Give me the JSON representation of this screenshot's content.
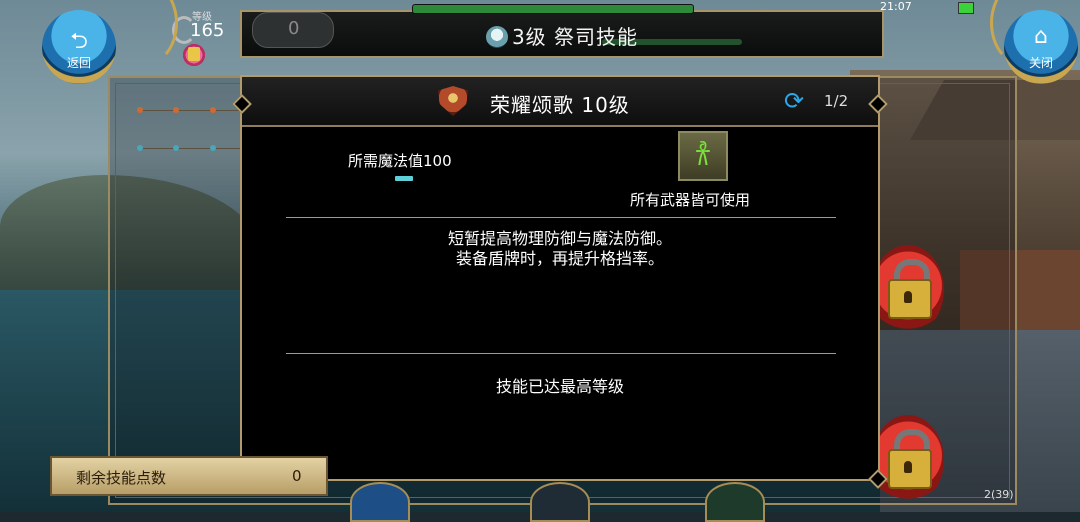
{
  "header": {
    "title": "3级 祭司技能",
    "level_label": "等级",
    "level_value": "165",
    "counter_value": "0",
    "clock": "21:07",
    "back_label": "返回",
    "close_label": "关闭"
  },
  "dialog": {
    "skill_name": "荣耀颂歌 10级",
    "page": "1/2",
    "mana_requirement": "所需魔法值100",
    "weapon_text": "所有武器皆可使用",
    "description_line1": "短暂提高物理防御与魔法防御。",
    "description_line2": "装备盾牌时，再提升格挡率。",
    "max_level_text": "技能已达最高等级"
  },
  "skill_points": {
    "label": "剩余技能点数",
    "value": "0"
  },
  "bottom": {
    "right_text": "2(39)"
  },
  "colors": {
    "gold_border": "#b29c6e",
    "accent_blue": "#2aa8e8",
    "mana_cyan": "#5fd0d8",
    "weapon_green": "#7be03a"
  }
}
